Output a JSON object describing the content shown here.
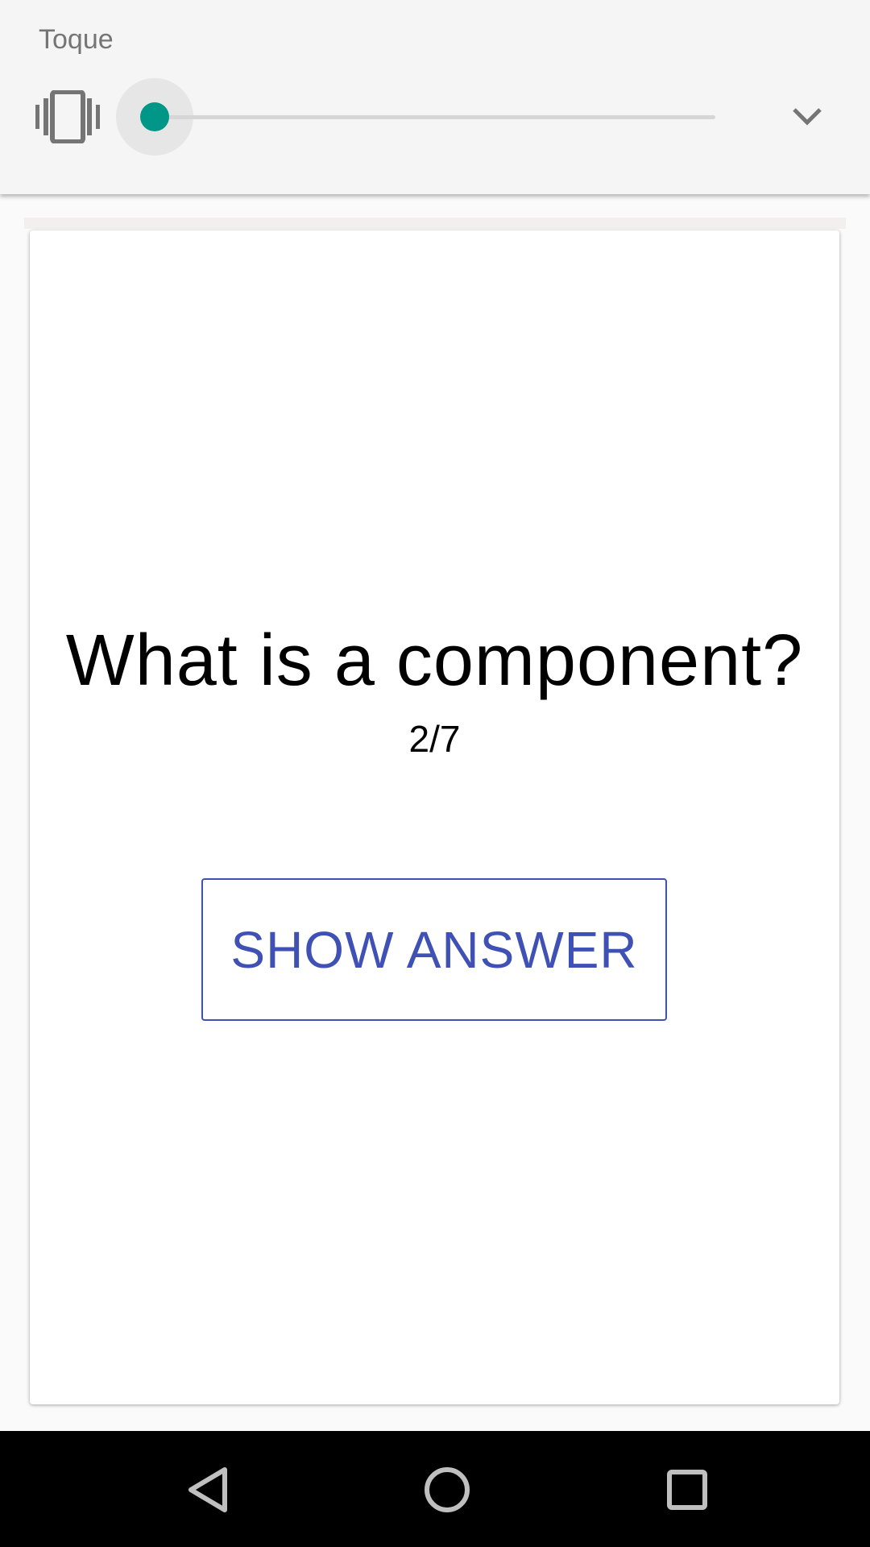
{
  "volume_panel": {
    "label": "Toque",
    "level": 0.0,
    "accent_color": "#009688",
    "mode_icon": "vibrate-icon",
    "expand_icon": "chevron-down-icon"
  },
  "card": {
    "question": "What is a component?",
    "counter": "2/7",
    "show_answer_label": "SHOW ANSWER",
    "button_color": "#3f51b5"
  },
  "navbar": {
    "icons": [
      "back-icon",
      "home-icon",
      "recents-icon"
    ]
  }
}
